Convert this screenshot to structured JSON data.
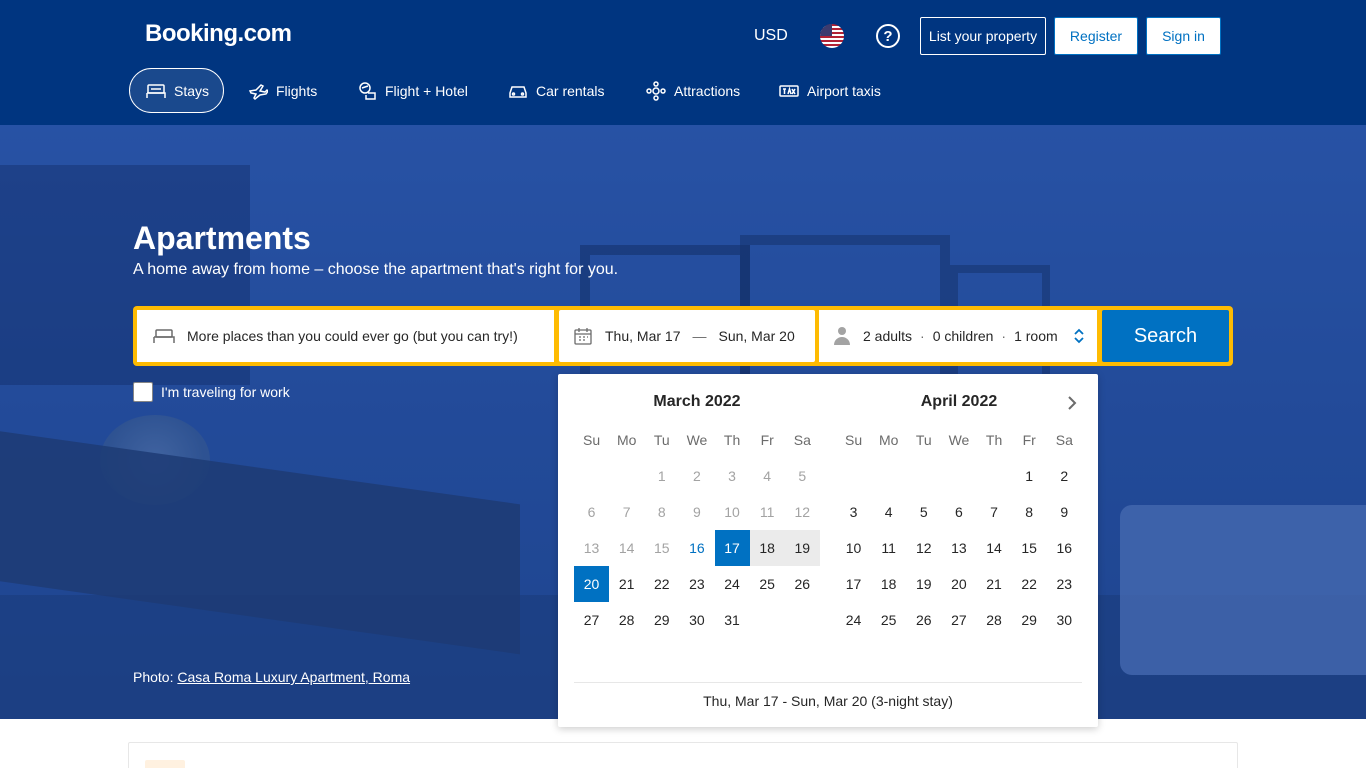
{
  "header": {
    "logo": "Booking.com",
    "currency": "USD",
    "help": "?",
    "list_property": "List your property",
    "register": "Register",
    "sign_in": "Sign in"
  },
  "nav": {
    "stays": "Stays",
    "flights": "Flights",
    "flight_hotel": "Flight + Hotel",
    "car_rentals": "Car rentals",
    "attractions": "Attractions",
    "airport_taxis": "Airport taxis"
  },
  "hero": {
    "title": "Apartments",
    "subtitle": "A home away from home – choose the apartment that's right for you.",
    "photo_label": "Photo: ",
    "photo_link": "Casa Roma Luxury Apartment, Roma"
  },
  "search": {
    "destination_placeholder": "More places than you could ever go (but you can try!)",
    "checkin": "Thu, Mar 17",
    "separator": "—",
    "checkout": "Sun, Mar 20",
    "adults": "2 adults",
    "children": "0 children",
    "rooms": "1 room",
    "dot": "·",
    "button": "Search",
    "work_label": "I'm traveling for work"
  },
  "calendar": {
    "weekdays": [
      "Su",
      "Mo",
      "Tu",
      "We",
      "Th",
      "Fr",
      "Sa"
    ],
    "months": [
      {
        "title": "March 2022",
        "weeks": [
          [
            "",
            "",
            "1",
            "2",
            "3",
            "4",
            "5"
          ],
          [
            "6",
            "7",
            "8",
            "9",
            "10",
            "11",
            "12"
          ],
          [
            "13",
            "14",
            "15",
            "16",
            "17",
            "18",
            "19"
          ],
          [
            "20",
            "21",
            "22",
            "23",
            "24",
            "25",
            "26"
          ],
          [
            "27",
            "28",
            "29",
            "30",
            "31",
            "",
            ""
          ]
        ]
      },
      {
        "title": "April 2022",
        "weeks": [
          [
            "",
            "",
            "",
            "",
            "",
            "1",
            "2"
          ],
          [
            "3",
            "4",
            "5",
            "6",
            "7",
            "8",
            "9"
          ],
          [
            "10",
            "11",
            "12",
            "13",
            "14",
            "15",
            "16"
          ],
          [
            "17",
            "18",
            "19",
            "20",
            "21",
            "22",
            "23"
          ],
          [
            "24",
            "25",
            "26",
            "27",
            "28",
            "29",
            "30"
          ]
        ]
      }
    ],
    "today": "16",
    "selected_start": "17",
    "selected_end": "20",
    "summary": "Thu, Mar 17 - Sun, Mar 20 (3-night stay)"
  },
  "colors": {
    "brand": "#003580",
    "accent": "#0071c2",
    "search_border": "#febb02"
  }
}
